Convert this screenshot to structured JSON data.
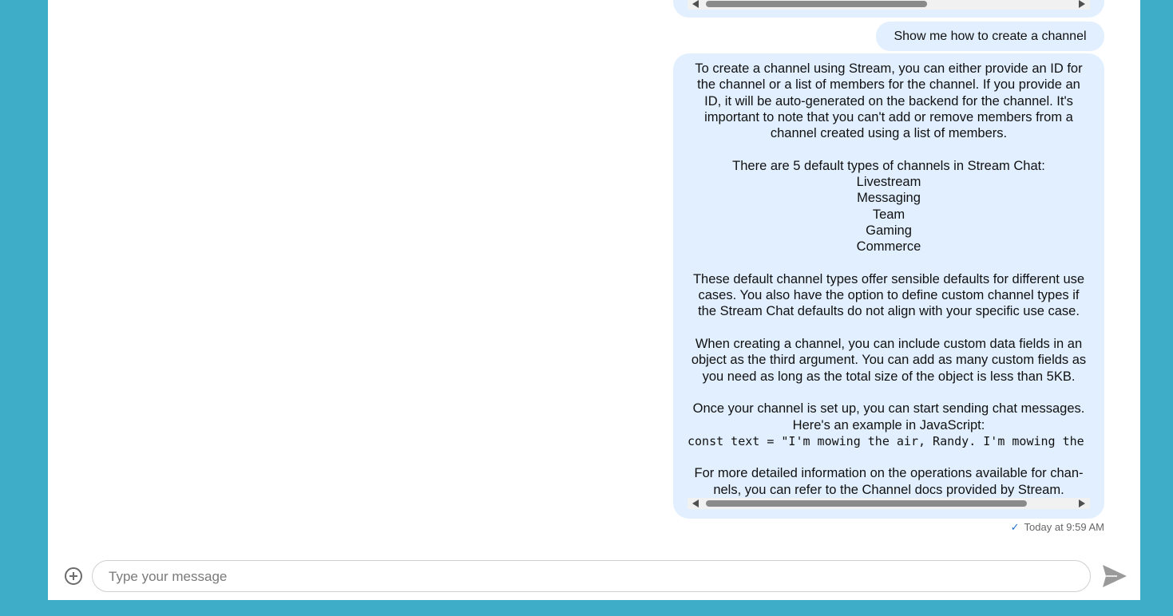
{
  "conversation": {
    "user_message": "Show me how to create a channel",
    "bot_paragraphs": [
      "To create a channel using Stream, you can either provide an ID for the channel or a list of members for the channel. If you provide an ID, it will be auto-generated on the backend for the channel. It's important to note that you can't add or remove members from a channel created using a list of members.",
      "There are 5 default types of channels in Stream Chat:",
      "These default channel types offer sensible defaults for different use cases. You also have the option to define custom channel types if the Stream Chat defaults do not align with your specific use case.",
      "When creating a channel, you can include custom data fields in an object as the third argument. You can add as many custom fields as you need as long as the total size of the object is less than 5KB.",
      "Once your channel is set up, you can start sending chat messages. Here's an example in JavaScript:",
      "For more detailed information on the operations available for chan-nels, you can refer to the Channel docs provided by Stream."
    ],
    "channel_types": [
      "Livestream",
      "Messaging",
      "Team",
      "Gaming",
      "Commerce"
    ],
    "code_line": "const text = \"I'm mowing the air, Randy. I'm mowing the",
    "timestamp": "Today at 9:59 AM"
  },
  "composer": {
    "placeholder": "Type your message"
  },
  "icons": {
    "add": "plus-circle-icon",
    "send": "send-icon",
    "read": "check-icon"
  },
  "colors": {
    "frame": "#3eaec8",
    "bubble": "#e1efff",
    "check": "#1e6fd1"
  }
}
